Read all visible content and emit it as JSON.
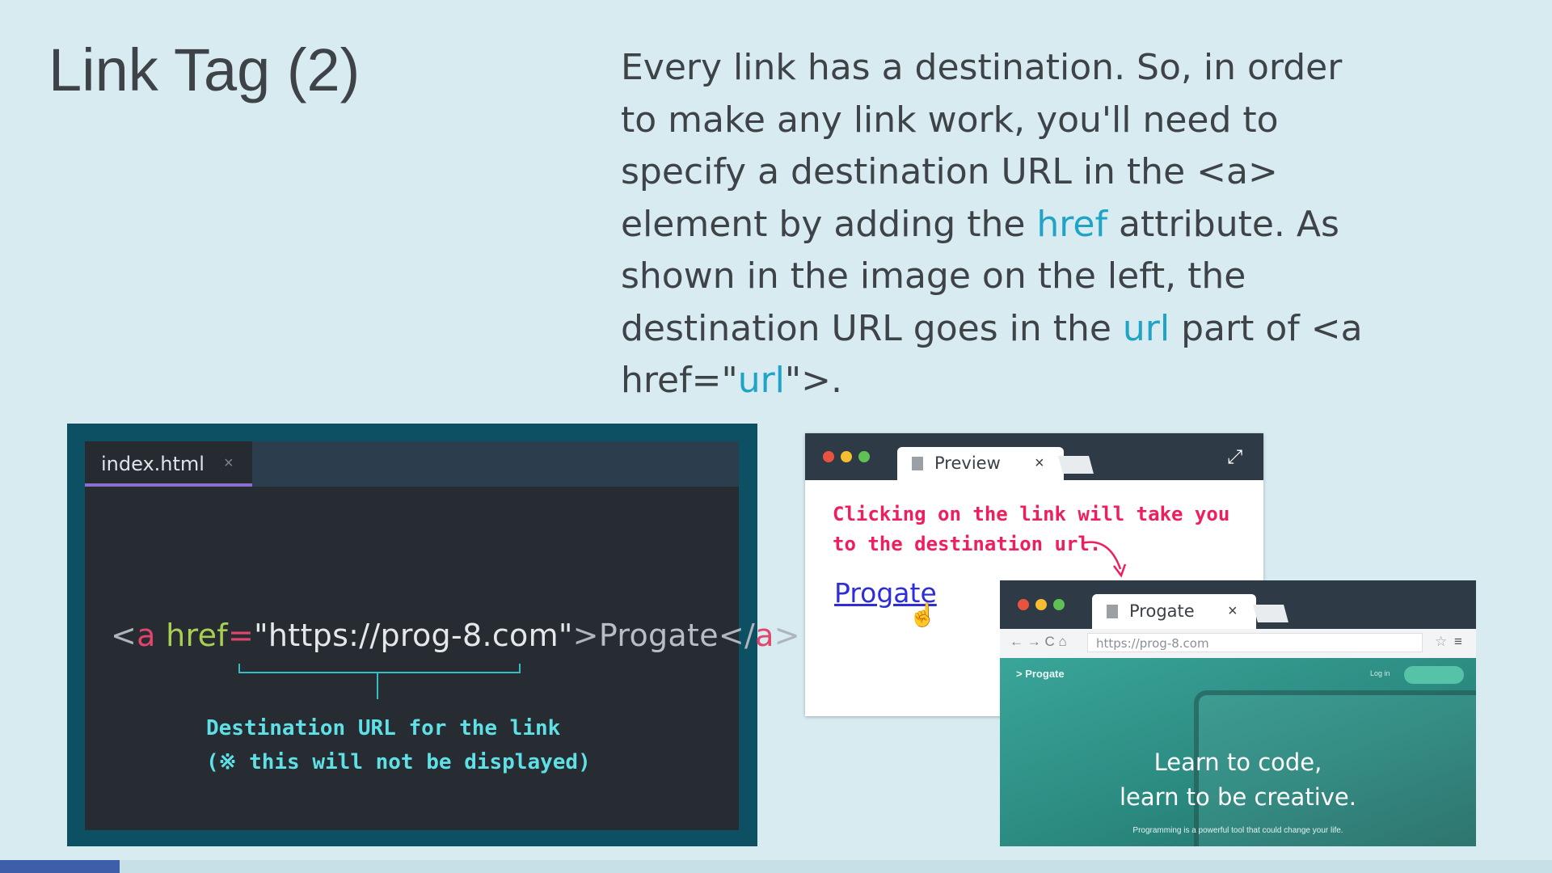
{
  "slide": {
    "title": "Link Tag (2)",
    "description": {
      "part1": "Every link has a destination. So, in order to make any link work, you'll need to specify a destination URL in the <a> element by adding the ",
      "href_word": "href",
      "part2": " attribute. As shown in the image on the left, the destination URL goes in the ",
      "url_word": "url",
      "part3": " part of <a href=\"",
      "url_word2": "url",
      "part4": "\">."
    },
    "progress": 0.077
  },
  "editor": {
    "tab_label": "index.html",
    "tab_close": "×",
    "code": {
      "open_bracket": "<",
      "tag": "a",
      "attr": " href",
      "eq": "=",
      "value": "\"https://prog-8.com\"",
      "close_bracket": ">",
      "text": "Progate",
      "end_open": "</",
      "end_tag": "a",
      "end_close": ">"
    },
    "annotation_line1": "Destination URL for the link",
    "annotation_line2": "(※ this will not be displayed)"
  },
  "preview_window": {
    "tab_label": "Preview",
    "tab_close": "×",
    "expand_icon": "⤢",
    "note_line1": "Clicking on the link will take you",
    "note_line2": "to the destination url.",
    "link_text": "Progate",
    "cursor_icon": "hand-pointer-icon"
  },
  "progate_window": {
    "tab_label": "Progate",
    "tab_close": "×",
    "nav_icons": "← → C ⌂",
    "url": "https://prog-8.com",
    "star": "☆",
    "menu": "≡",
    "logo": "> Progate",
    "login": "Log in",
    "headline_line1": "Learn to code,",
    "headline_line2": "learn to be creative.",
    "small_text": "Programming is a powerful tool that could change your life."
  },
  "colors": {
    "background": "#d7ebf1",
    "highlight": "#1fa3c6",
    "progress": "#3d5ea8"
  }
}
